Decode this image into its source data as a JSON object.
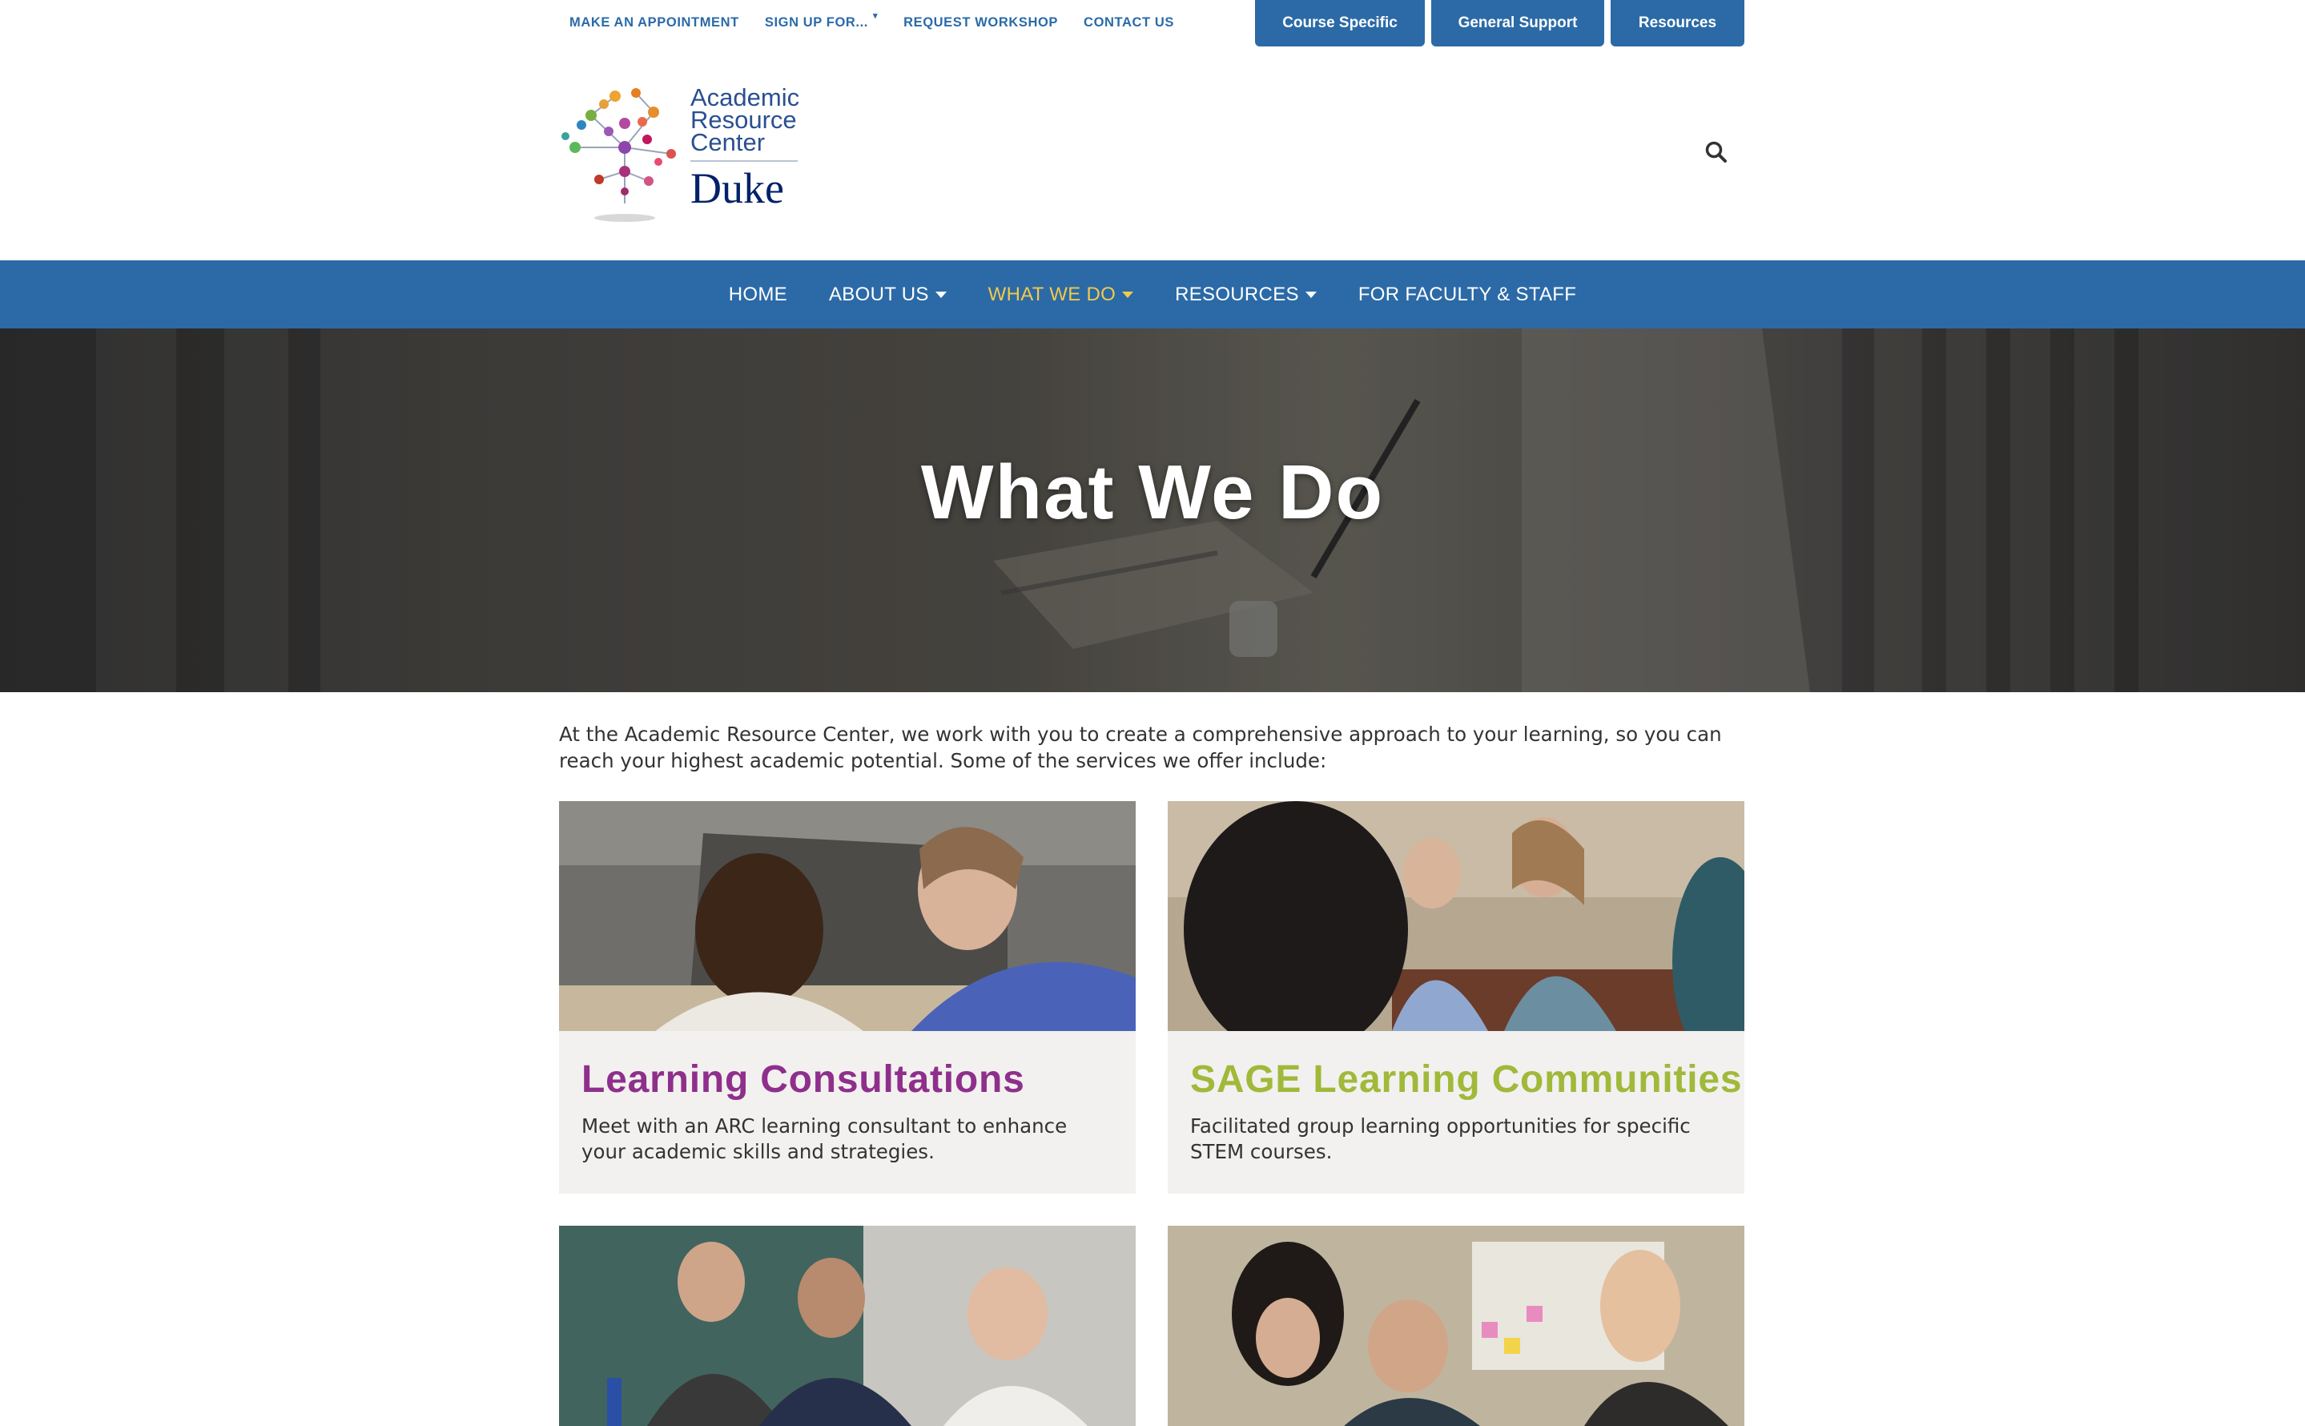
{
  "utility_nav": {
    "links": [
      "MAKE AN APPOINTMENT",
      "SIGN UP FOR...",
      "REQUEST WORKSHOP",
      "CONTACT US"
    ],
    "buttons": [
      "Course Specific",
      "General Support",
      "Resources"
    ]
  },
  "logo": {
    "line1": "Academic",
    "line2": "Resource",
    "line3": "Center",
    "institution": "Duke"
  },
  "search": {
    "icon": "search-icon"
  },
  "main_nav": {
    "items": [
      {
        "label": "HOME",
        "dropdown": false
      },
      {
        "label": "ABOUT US",
        "dropdown": true
      },
      {
        "label": "WHAT WE DO",
        "dropdown": true,
        "active": true
      },
      {
        "label": "RESOURCES",
        "dropdown": true
      },
      {
        "label": "FOR FACULTY & STAFF",
        "dropdown": false
      }
    ]
  },
  "hero": {
    "title": "What We Do"
  },
  "intro": "At the Academic Resource Center, we work with you to create a comprehensive approach to your learning, so you can reach your highest academic potential. Some of the services we offer include:",
  "cards": [
    {
      "title": "Learning Consultations",
      "desc": "Meet with an ARC learning consultant to enhance your academic skills and strategies.",
      "color": "#8f2f8c"
    },
    {
      "title": "SAGE Learning Communities",
      "desc": "Facilitated group learning opportunities for specific STEM courses.",
      "color": "#a0b93a"
    }
  ],
  "colors": {
    "brand_blue": "#2b6aa6",
    "nav_active": "#f2c94c"
  }
}
